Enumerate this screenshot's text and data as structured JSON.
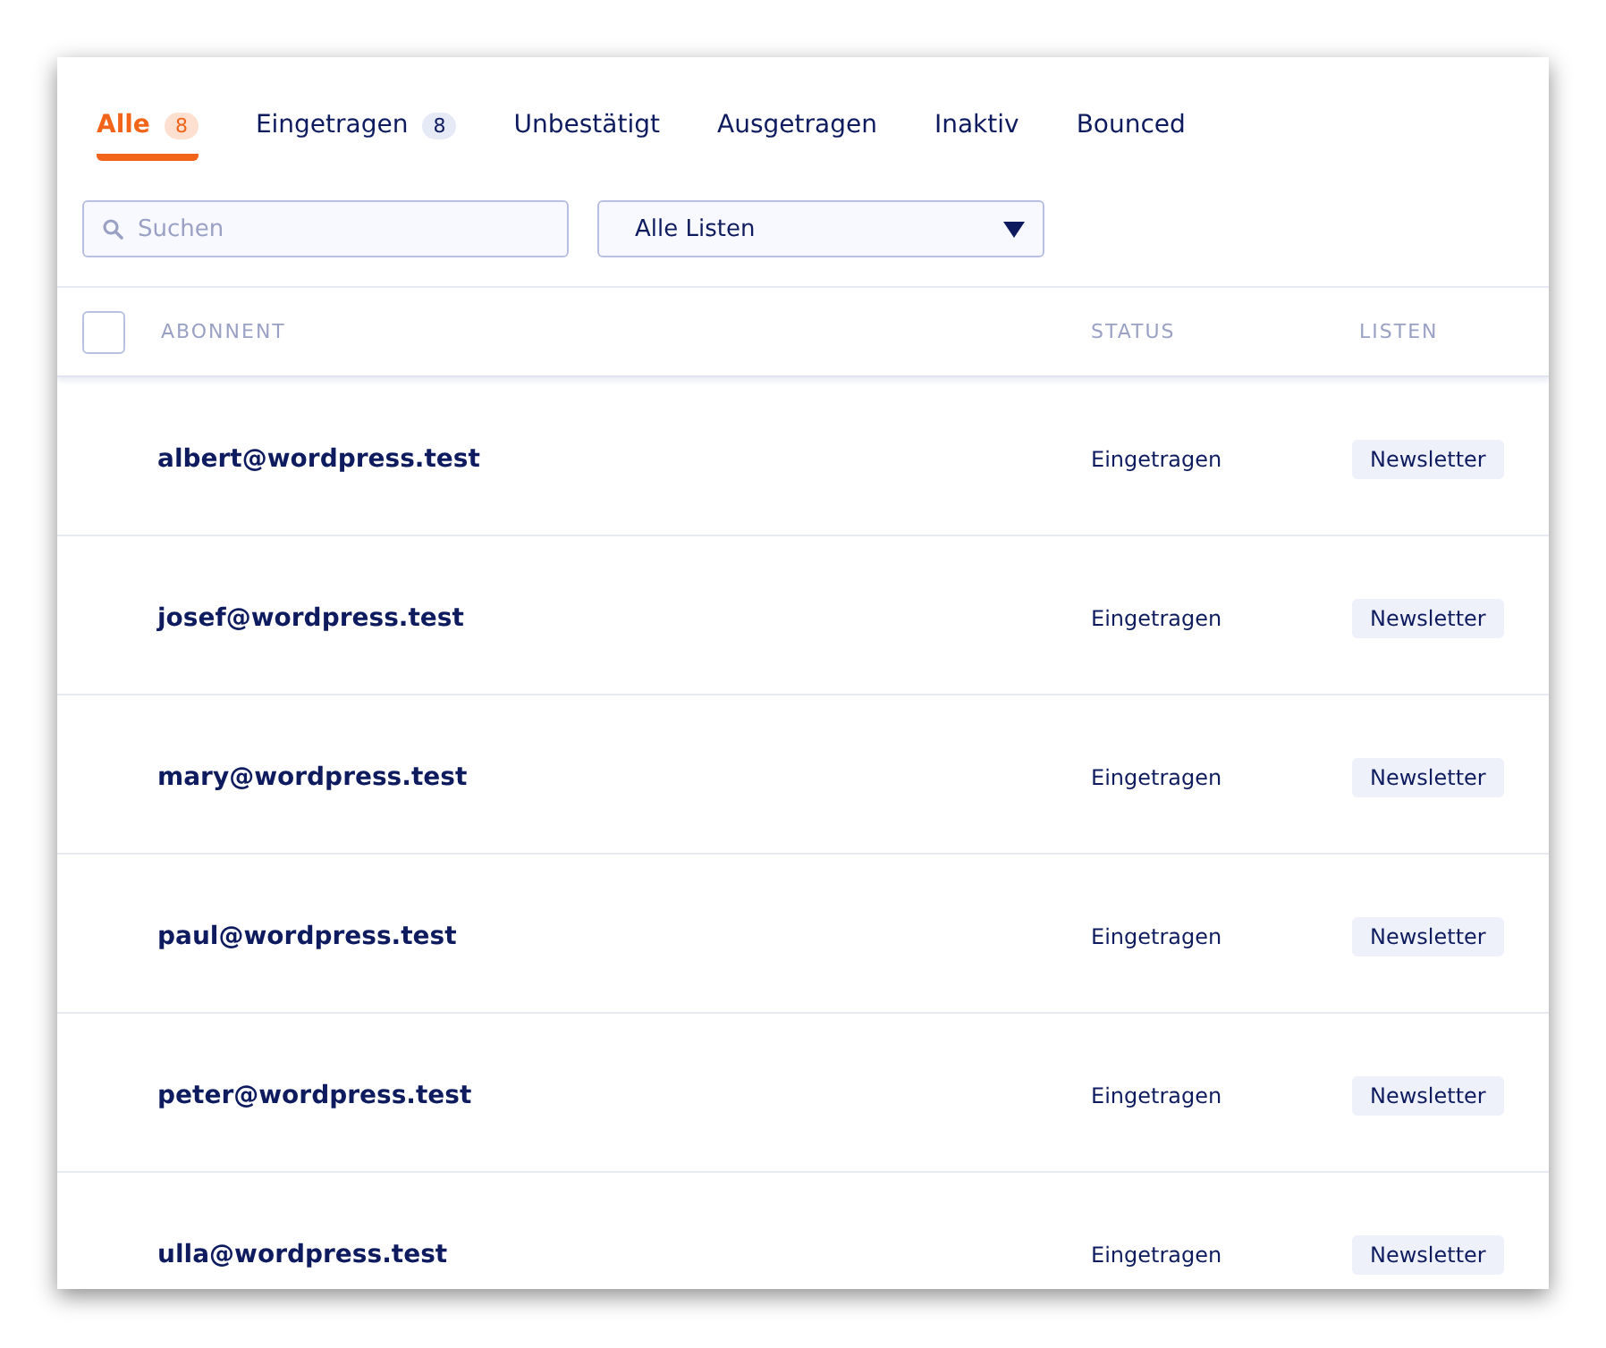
{
  "tabs": [
    {
      "label": "Alle",
      "count": "8",
      "selected": true
    },
    {
      "label": "Eingetragen",
      "count": "8",
      "selected": false
    },
    {
      "label": "Unbestätigt",
      "selected": false
    },
    {
      "label": "Ausgetragen",
      "selected": false
    },
    {
      "label": "Inaktiv",
      "selected": false
    },
    {
      "label": "Bounced",
      "selected": false
    }
  ],
  "search": {
    "placeholder": "Suchen"
  },
  "list_filter": {
    "value": "Alle Listen"
  },
  "table": {
    "select_all": {
      "checked": false
    },
    "columns": [
      "ABONNENT",
      "STATUS",
      "LISTEN"
    ],
    "rows": [
      {
        "email": "albert@wordpress.test",
        "status": "Eingetragen",
        "list": "Newsletter"
      },
      {
        "email": "josef@wordpress.test",
        "status": "Eingetragen",
        "list": "Newsletter"
      },
      {
        "email": "mary@wordpress.test",
        "status": "Eingetragen",
        "list": "Newsletter"
      },
      {
        "email": "paul@wordpress.test",
        "status": "Eingetragen",
        "list": "Newsletter"
      },
      {
        "email": "peter@wordpress.test",
        "status": "Eingetragen",
        "list": "Newsletter"
      },
      {
        "email": "ulla@wordpress.test",
        "status": "Eingetragen",
        "list": "Newsletter"
      }
    ]
  }
}
